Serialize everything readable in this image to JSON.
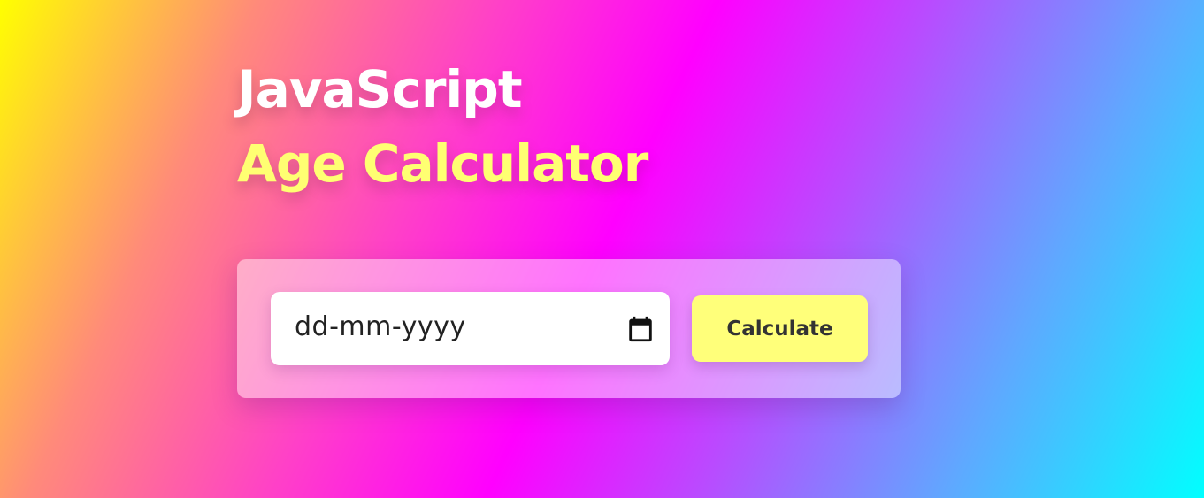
{
  "header": {
    "title_line1": "JavaScript",
    "title_line2": "Age Calculator"
  },
  "form": {
    "date_placeholder": "dd-mm-yyyy",
    "date_value": "",
    "calendar_icon": "calendar-icon",
    "calculate_label": "Calculate"
  },
  "colors": {
    "title_primary": "#ffffff",
    "title_accent": "#ffff72",
    "button_bg": "#ffff7a",
    "button_text": "#333333",
    "gradient": [
      "#ffff00",
      "#ff00ff",
      "#00ffff"
    ]
  }
}
